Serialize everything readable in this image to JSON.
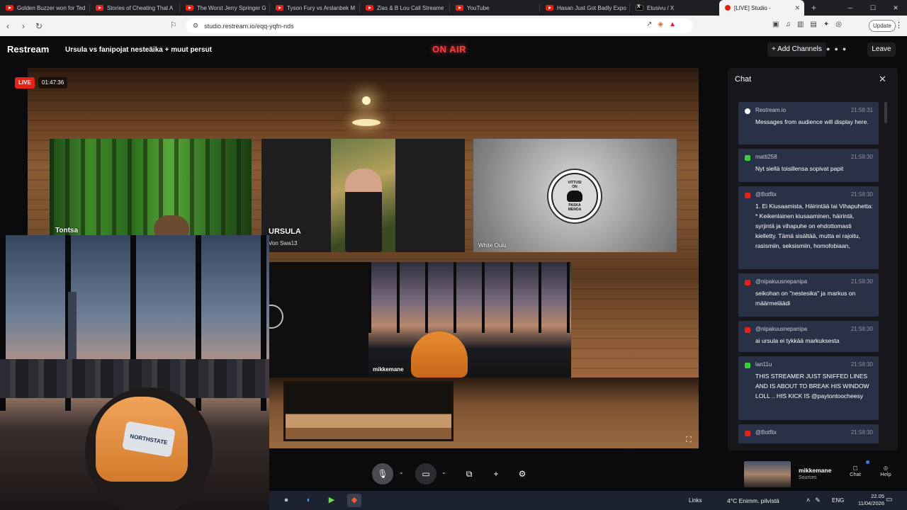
{
  "browser": {
    "tabs": [
      {
        "title": "Golden Buzzer won for Ted",
        "icon": "youtube-icon"
      },
      {
        "title": "Stories of Cheating That A",
        "icon": "youtube-icon"
      },
      {
        "title": "The Worst Jerry Springer G",
        "icon": "youtube-icon"
      },
      {
        "title": "Tyson Fury vs Arslanbek M",
        "icon": "youtube-icon"
      },
      {
        "title": "Zias & B Lou Call Streame",
        "icon": "youtube-icon"
      },
      {
        "title": "YouTube",
        "icon": "youtube-icon"
      },
      {
        "title": "Hasan Just Got Badly Expo",
        "icon": "youtube-icon"
      },
      {
        "title": "Etusivu / X",
        "icon": "x-icon"
      },
      {
        "title": "[LIVE] Studio -",
        "icon": "restream-icon",
        "active": true
      }
    ],
    "url": "studio.restream.io/eqq-yqfn-nds",
    "update_label": "Update"
  },
  "header": {
    "logo": "Restream",
    "stream_title": "Ursula vs fanipojat nesteäika + muut persut",
    "on_air": "ON AIR",
    "add_channels": "+ Add Channels",
    "leave": "Leave"
  },
  "stage": {
    "live_badge": "LIVE",
    "timer": "01:47:36",
    "participants": {
      "tontsa": "Tontsa",
      "ursula_name": "URSULA",
      "ursula_sub": "Von Swa13",
      "white": "White Oulu",
      "mikke": "mikkemane"
    },
    "white_logo_text": {
      "top": "VITTUSI",
      "mid": "ON",
      "bottom": "PASKA",
      "end": "MENOA"
    },
    "selfcam_logo": "NORTHSTATE"
  },
  "chat": {
    "title": "Chat",
    "messages": [
      {
        "source": "restream",
        "author": "Restream.io",
        "time": "21:58:31",
        "text": "Messages from audience will display here."
      },
      {
        "source": "kick",
        "author": "matti258",
        "time": "21:58:30",
        "text": "Nyt siellä toisillensa sopivat papit"
      },
      {
        "source": "youtube",
        "author": "@Botflix",
        "time": "21:58:30",
        "text": "1. Ei Kiusaamista, Häirintää tai Vihapuhetta: * Keikenlainen kiusaaminen, häirintä, syrjintä ja vihapuhe on ehdottomasti kielletty. Tämä sisältää, mutta ei rajoitu, rasismiin, seksismiin, homofobiaan,"
      },
      {
        "source": "youtube",
        "author": "@nipakuusnepanipa",
        "time": "21:58:30",
        "text": "seikohan on \"nestesika\" ja markus on määrmeläädi"
      },
      {
        "source": "youtube",
        "author": "@nipakuusnepanipa",
        "time": "21:58:30",
        "text": "ai ursula ei tykkää markuksesta"
      },
      {
        "source": "kick",
        "author": "lan11u",
        "time": "21:58:30",
        "text": "THIS STREAMER JUST SNIFFED LINES AND IS ABOUT TO BREAK HIS WINDOW LOLL .. HIS KICK IS @paytontoocheesy"
      },
      {
        "source": "youtube",
        "author": "@Botflix",
        "time": "21:58:30",
        "text": ""
      }
    ]
  },
  "controls": {
    "mini_name": "mikkemane",
    "mini_sources": "Sources",
    "chat_label": "Chat",
    "help_label": "Help"
  },
  "taskbar": {
    "links": "Links",
    "weather": "4°C  Enimm. pilvistä",
    "lang": "ENG",
    "time": "22.05",
    "date": "11/04/2026"
  },
  "colors": {
    "on_air": "#ff3b3b",
    "live": "#e62117",
    "chat_card": "#283145",
    "kick": "#3ad13a"
  }
}
